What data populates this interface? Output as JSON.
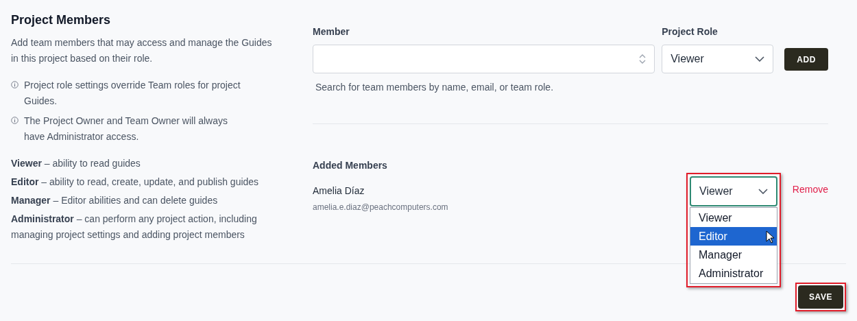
{
  "section": {
    "title": "Project Members",
    "description": "Add team members that may access and manage the Guides in this project based on their role.",
    "notes": [
      "Project role settings override Team roles for project Guides.",
      "The Project Owner and Team Owner will always have Administrator access."
    ],
    "roles": [
      "**Viewer** – ability to read guides",
      "**Editor** – ability to read, create, update, and publish guides",
      "**Manager** – Editor abilities and can delete guides",
      "**Administrator** – can perform any project action, including managing project settings and adding project members"
    ]
  },
  "add_form": {
    "member_label": "Member",
    "hint": "Search for team members by name, email, or team role.",
    "role_label": "Project Role",
    "role_value": "Viewer",
    "add_button": "ADD"
  },
  "added": {
    "title": "Added Members",
    "members": [
      {
        "name": "Amelia Díaz",
        "email": "amelia.e.diaz@peachcomputers.com",
        "role": "Viewer",
        "expanded": true,
        "remove": "Remove",
        "options": [
          {
            "label": "Viewer",
            "selected": false
          },
          {
            "label": "Editor",
            "selected": true
          },
          {
            "label": "Manager",
            "selected": false
          },
          {
            "label": "Administrator",
            "selected": false
          }
        ]
      }
    ]
  },
  "save_button": "SAVE"
}
